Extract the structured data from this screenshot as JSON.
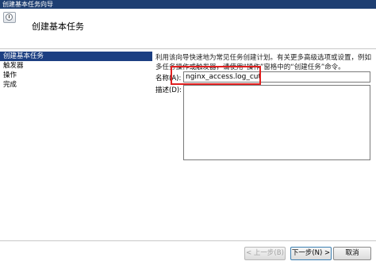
{
  "window": {
    "title": "创建基本任务向导"
  },
  "header": {
    "title": "创建基本任务"
  },
  "steps": [
    {
      "label": "创建基本任务"
    },
    {
      "label": "触发器"
    },
    {
      "label": "操作"
    },
    {
      "label": "完成"
    }
  ],
  "content": {
    "description": "利用该向导快速地为常见任务创建计划。有关更多高级选项或设置，例如多任务操作或触发器，请使用“操作”窗格中的“创建任务”命令。",
    "name_label": "名称(A):",
    "name_value": "nginx_access.log_cut",
    "desc_label": "描述(D):",
    "desc_value": ""
  },
  "footer": {
    "back_label": "< 上一步(B)",
    "next_label": "下一步(N) >",
    "cancel_label": "取消"
  }
}
